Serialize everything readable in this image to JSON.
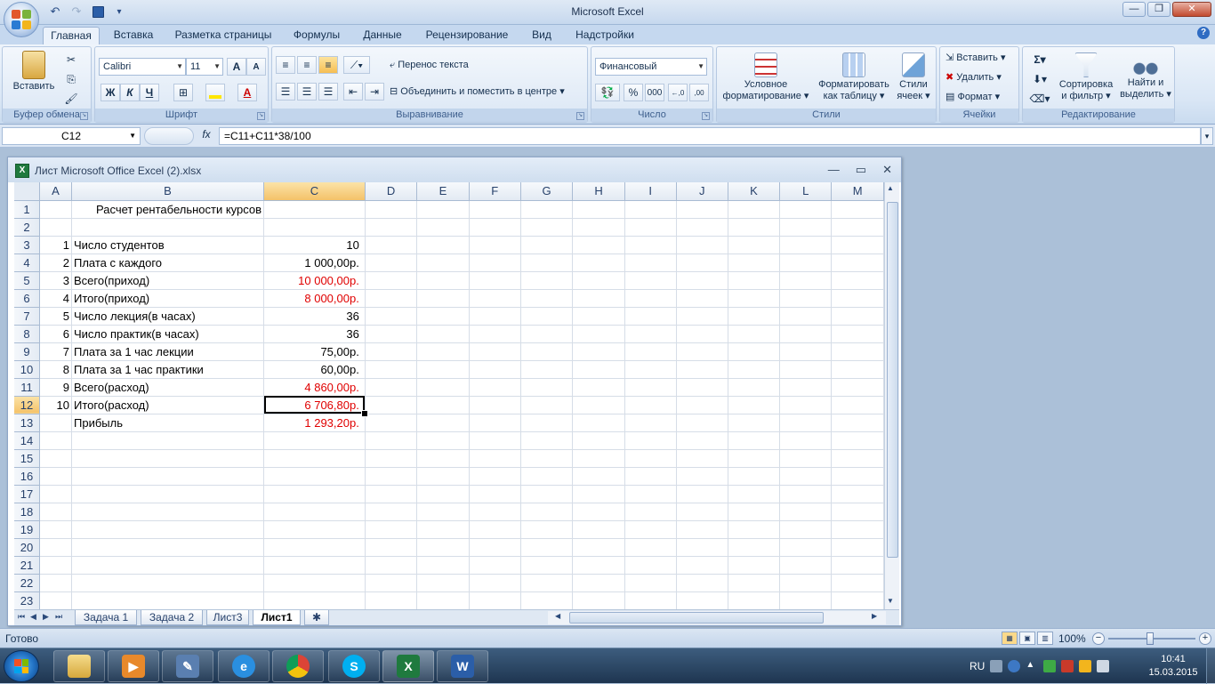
{
  "app": {
    "title": "Microsoft Excel",
    "window_buttons": {
      "minimize": "—",
      "maximize": "❐",
      "close": "✕"
    }
  },
  "qat": {
    "undo": "↶",
    "redo": "↷",
    "save": "💾",
    "more": "▾"
  },
  "tabs": [
    "Главная",
    "Вставка",
    "Разметка страницы",
    "Формулы",
    "Данные",
    "Рецензирование",
    "Вид",
    "Надстройки"
  ],
  "ribbon": {
    "clipboard": {
      "label": "Буфер обмена",
      "paste": "Вставить"
    },
    "font": {
      "label": "Шрифт",
      "name": "Calibri",
      "size": "11",
      "bold": "Ж",
      "italic": "К",
      "underline": "Ч",
      "grow": "A",
      "shrink": "A"
    },
    "alignment": {
      "label": "Выравнивание",
      "wrap": "Перенос текста",
      "merge": "Объединить и поместить в центре"
    },
    "number": {
      "label": "Число",
      "format": "Финансовый",
      "percent": "%",
      "thousands": "000",
      "inc_dec": "←,0",
      "dec_dec": ",00"
    },
    "styles": {
      "label": "Стили",
      "cond_format": [
        "Условное",
        "форматирование ▾"
      ],
      "format_table": [
        "Форматировать",
        "как таблицу ▾"
      ],
      "cell_styles": [
        "Стили",
        "ячеек ▾"
      ]
    },
    "cells": {
      "label": "Ячейки",
      "insert": "Вставить",
      "delete": "Удалить",
      "format": "Формат"
    },
    "editing": {
      "label": "Редактирование",
      "sum": "Σ",
      "sort": [
        "Сортировка",
        "и фильтр ▾"
      ],
      "find": [
        "Найти и",
        "выделить ▾"
      ]
    }
  },
  "formula_bar": {
    "name_box": "C12",
    "fx": "fx",
    "formula": "=C11+C11*38/100"
  },
  "workbook": {
    "title": "Лист Microsoft Office Excel (2).xlsx",
    "icon_text": "X",
    "controls": {
      "min": "—",
      "max": "▭",
      "close": "✕"
    },
    "columns": [
      "A",
      "B",
      "C",
      "D",
      "E",
      "F",
      "G",
      "H",
      "I",
      "J",
      "K",
      "L",
      "M"
    ],
    "rows": [
      {
        "n": "1",
        "a": "",
        "b": "Расчет рентабельности курсов",
        "c": ""
      },
      {
        "n": "2",
        "a": "",
        "b": "",
        "c": ""
      },
      {
        "n": "3",
        "a": "1",
        "b": "Число студентов",
        "c": "10"
      },
      {
        "n": "4",
        "a": "2",
        "b": "Плата с каждого",
        "c": "1 000,00р."
      },
      {
        "n": "5",
        "a": "3",
        "b": "Всего(приход)",
        "c": "10 000,00р."
      },
      {
        "n": "6",
        "a": "4",
        "b": "Итого(приход)",
        "c": "8 000,00р."
      },
      {
        "n": "7",
        "a": "5",
        "b": "Число лекция(в часах)",
        "c": "36"
      },
      {
        "n": "8",
        "a": "6",
        "b": "Число практик(в часах)",
        "c": "36"
      },
      {
        "n": "9",
        "a": "7",
        "b": "Плата за 1 час лекции",
        "c": "75,00р."
      },
      {
        "n": "10",
        "a": "8",
        "b": "Плата за 1 час практики",
        "c": "60,00р."
      },
      {
        "n": "11",
        "a": "9",
        "b": "Всего(расход)",
        "c": "4 860,00р."
      },
      {
        "n": "12",
        "a": "10",
        "b": "Итого(расход)",
        "c": "6 706,80р."
      },
      {
        "n": "13",
        "a": "",
        "b": "Прибыль",
        "c": "1 293,20р."
      },
      {
        "n": "14",
        "a": "",
        "b": "",
        "c": ""
      },
      {
        "n": "15",
        "a": "",
        "b": "",
        "c": ""
      },
      {
        "n": "16",
        "a": "",
        "b": "",
        "c": ""
      },
      {
        "n": "17",
        "a": "",
        "b": "",
        "c": ""
      },
      {
        "n": "18",
        "a": "",
        "b": "",
        "c": ""
      },
      {
        "n": "19",
        "a": "",
        "b": "",
        "c": ""
      },
      {
        "n": "20",
        "a": "",
        "b": "",
        "c": ""
      },
      {
        "n": "21",
        "a": "",
        "b": "",
        "c": ""
      },
      {
        "n": "22",
        "a": "",
        "b": "",
        "c": ""
      },
      {
        "n": "23",
        "a": "",
        "b": "",
        "c": ""
      }
    ],
    "sheet_tabs": [
      "Задача 1",
      "Задача 2",
      "Лист3",
      "Лист1"
    ],
    "active_sheet": "Лист1"
  },
  "status": {
    "text": "Готово",
    "zoom": "100%",
    "minus": "−",
    "plus": "+"
  },
  "taskbar": {
    "lang": "RU",
    "time": "10:41",
    "date": "15.03.2015"
  },
  "colors": {
    "accent": "#2f6cc3",
    "red_value": "#e00000",
    "excel_green": "#1f7a3e"
  }
}
